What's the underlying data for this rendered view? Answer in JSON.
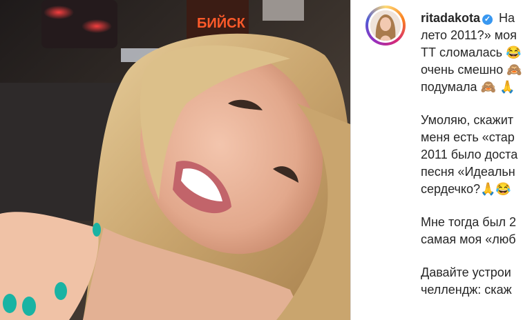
{
  "post": {
    "username": "ritadakota",
    "verified_mark": "✓",
    "caption_first": "На",
    "paragraphs": [
      [
        "лето 2011?» моя",
        "ТТ сломалась 😂",
        "очень смешно 🙈",
        "подумала 🙈 🙏"
      ],
      [
        "Умоляю, скажит",
        "меня есть «стар",
        "2011 было доста",
        "песня «Идеальн",
        "сердечко?🙏😂"
      ],
      [
        "Мне тогда был 2",
        "самая моя «люб"
      ],
      [
        "Давайте устрои",
        "челлендж: скаж"
      ]
    ]
  },
  "photo": {
    "sign_text": "БИЙСК",
    "description_icon": "selfie-photo"
  },
  "colors": {
    "verified": "#3897f0",
    "text": "#262626",
    "nails": "#19b3a3"
  }
}
